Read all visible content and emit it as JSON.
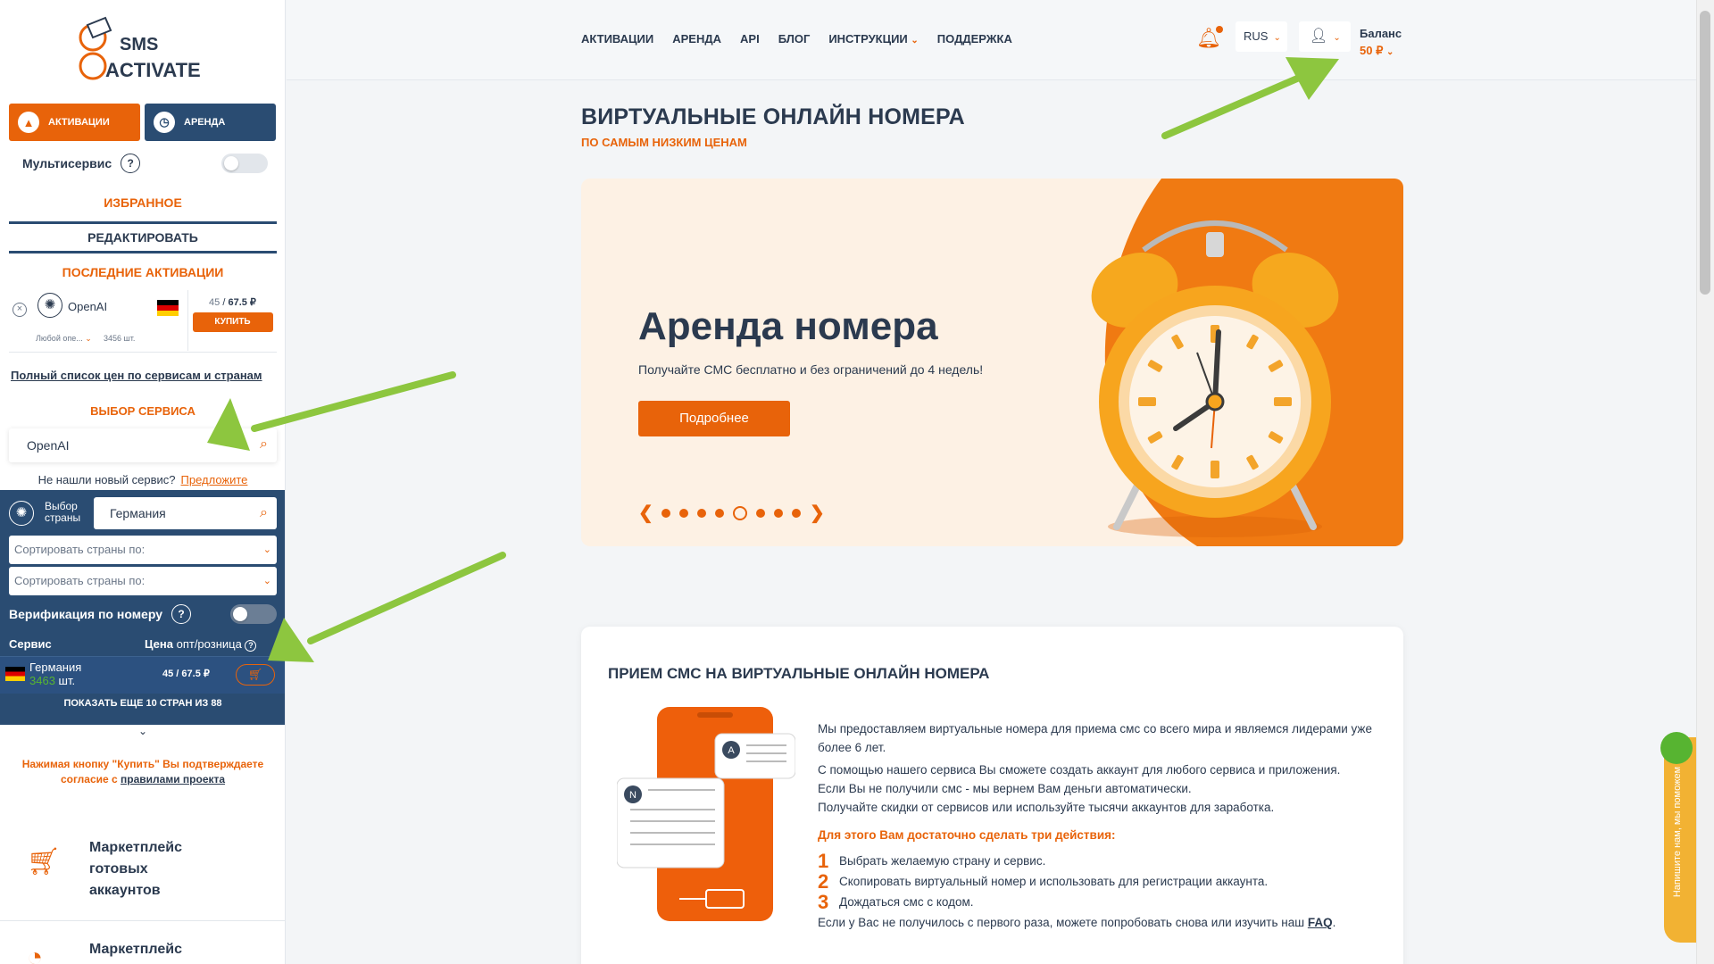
{
  "sidebar": {
    "logo_text_1": "SMS",
    "logo_text_2": "ACTIVATE",
    "mode_activation": "АКТИВАЦИИ",
    "mode_rent": "АРЕНДА",
    "multiservice_label": "Мультисервис",
    "help_glyph": "?",
    "favorites_title": "ИЗБРАННОЕ",
    "edit_label": "РЕДАКТИРОВАТЬ",
    "last_activations_title": "ПОСЛЕДНИЕ АКТИВАЦИИ",
    "last_item": {
      "service": "OpenAI",
      "operator": "Любой опе...",
      "count": "3456 шт.",
      "price_wholesale": "45",
      "price_retail": "67.5 ₽",
      "buy_label": "КУПИТЬ"
    },
    "full_price_link": "Полный список цен по сервисам и странам",
    "service_choice_title": "ВЫБОР СЕРВИСА",
    "service_search_value": "OpenAI",
    "not_found_text": "Не нашли новый сервис?",
    "suggest_link": "Предложите",
    "country_choice_label_1": "Выбор",
    "country_choice_label_2": "страны",
    "country_search_value": "Германия",
    "sort_placeholder_1": "Сортировать страны по:",
    "sort_placeholder_2": "Сортировать страны по:",
    "verification_label": "Верификация по номеру",
    "table_header_service": "Сервис",
    "table_header_price_bold": "Цена",
    "table_header_price_rest": "опт/розница",
    "country_row": {
      "name": "Германия",
      "count_number": "3463",
      "count_unit": "шт.",
      "price": "45 / 67.5 ₽"
    },
    "show_more": "ПОКАЗАТЬ ЕЩЕ 10 СТРАН ИЗ 88",
    "agree_text": "Нажимая кнопку \"Купить\" Вы подтверждаете согласие с",
    "agree_link": "правилами проекта",
    "market_1": [
      "Маркетплейс",
      "готовых",
      "аккаунтов"
    ],
    "market_2": "Маркетплейс"
  },
  "header": {
    "nav": [
      "АКТИВАЦИИ",
      "АРЕНДА",
      "API",
      "БЛОГ",
      "ИНСТРУКЦИИ",
      "ПОДДЕРЖКА"
    ],
    "language": "RUS",
    "balance_label": "Баланс",
    "balance_value": "50 ₽"
  },
  "main": {
    "title": "ВИРТУАЛЬНЫЕ ОНЛАЙН НОМЕРА",
    "subtitle": "ПО САМЫМ НИЗКИМ ЦЕНАМ",
    "banner": {
      "title": "Аренда номера",
      "text": "Получайте СМС бесплатно и без ограничений до 4 недель!",
      "button": "Подробнее",
      "slides_total": 8,
      "active_slide": 5
    },
    "card": {
      "title": "ПРИЕМ СМС НА ВИРТУАЛЬНЫЕ ОНЛАЙН НОМЕРА",
      "p1": "Мы предоставляем виртуальные номера для приема смс со всего мира и являемся лидерами уже более 6 лет.",
      "p2_1": "С помощью нашего сервиса Вы сможете создать аккаунт для любого сервиса и приложения.",
      "p2_2": "Если Вы не получили смс - мы вернем Вам деньги автоматически.",
      "p2_3": "Получайте скидки от сервисов или используйте тысячи аккаунтов для заработка.",
      "steps_title": "Для этого Вам достаточно сделать три действия:",
      "steps": [
        {
          "num": "1",
          "text": "Выбрать желаемую страну и сервис."
        },
        {
          "num": "2",
          "text": "Скопировать виртуальный номер и использовать для регистрации аккаунта."
        },
        {
          "num": "3",
          "text": "Дождаться смс с кодом."
        }
      ],
      "faq_text": "Если у Вас не получилось с первого раза, можете попробовать снова или изучить наш",
      "faq_link": "FAQ",
      "bubble_a": "A",
      "bubble_n": "N"
    }
  },
  "help_widget": "Напишите нам, мы поможем",
  "colors": {
    "accent": "#e8630a",
    "navy": "#2a4c72",
    "text": "#2b3a4f",
    "annotation_arrow": "#8dc63f"
  }
}
